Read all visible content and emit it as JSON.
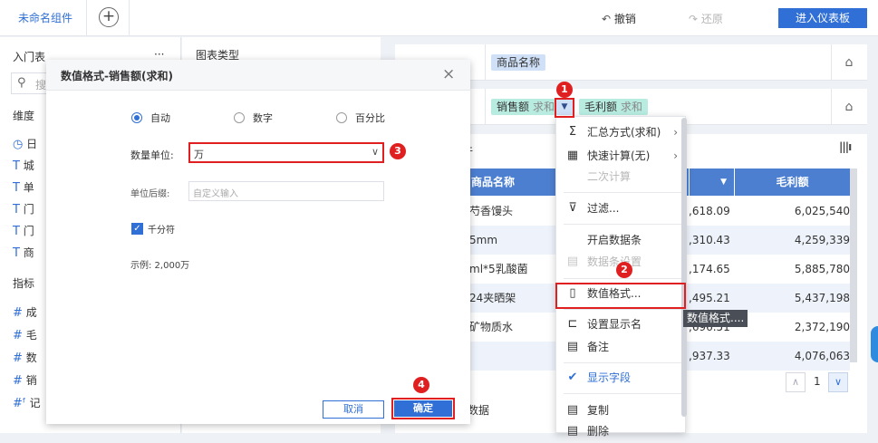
{
  "topbar": {
    "tab_label": "未命名组件",
    "add_icon": "plus-icon",
    "undo_label": "撤销",
    "redo_label": "还原",
    "enter_label": "进入仪表板"
  },
  "left_panel": {
    "title": "入门表",
    "more_label": "···",
    "search_placeholder": "搜",
    "dimension_label": "维度",
    "dimensions": [
      {
        "icon": "◷",
        "label": "日"
      },
      {
        "icon": "T",
        "label": "城"
      },
      {
        "icon": "T",
        "label": "单"
      },
      {
        "icon": "T",
        "label": "门"
      },
      {
        "icon": "T",
        "label": "门"
      },
      {
        "icon": "T",
        "label": "商"
      }
    ],
    "measure_label": "指标",
    "measures": [
      {
        "icon": "#",
        "label": "成"
      },
      {
        "icon": "#",
        "label": "毛"
      },
      {
        "icon": "#",
        "label": "数"
      },
      {
        "icon": "#",
        "label": "销"
      },
      {
        "icon": "#ᶠ",
        "label": "记"
      }
    ]
  },
  "mid_panel": {
    "chart_type_label": "图表类型",
    "data_label": "数据",
    "partial_label": "件"
  },
  "fields": {
    "row1": {
      "pill": "商品名称"
    },
    "row2": {
      "pill1": "销售额",
      "pill1_sub": "求和",
      "pill2": "毛利额",
      "pill2_sub": "求和"
    }
  },
  "table": {
    "headers": [
      "商品名称",
      "",
      "毛利额"
    ],
    "rows": [
      [
        "芍香馒头",
        ",618.09",
        "6,025,540"
      ],
      [
        "5mm",
        ",310.43",
        "4,259,339"
      ],
      [
        "ml*5乳酸菌",
        ",174.65",
        "5,885,780"
      ],
      [
        "24夹晒架",
        ",495.21",
        "5,437,198"
      ],
      [
        "矿物质水",
        ",696.51",
        "2,372,190"
      ],
      [
        "",
        ",937.33",
        "4,076,063"
      ]
    ],
    "page": "1"
  },
  "modal": {
    "title": "数值格式-销售额(求和)",
    "close": "×",
    "radio_options": [
      "自动",
      "数字",
      "百分比"
    ],
    "unit_label": "数量单位:",
    "unit_value": "万",
    "suffix_label": "单位后缀:",
    "suffix_placeholder": "自定义输入",
    "thousands_label": "千分符",
    "example_label": "示例: 2,000万",
    "cancel_label": "取消",
    "ok_label": "确定"
  },
  "context_menu": {
    "items": [
      {
        "icon": "Σ",
        "label": "汇总方式(求和)",
        "arrow": "›",
        "disabled": false
      },
      {
        "icon": "▦",
        "label": "快速计算(无)",
        "arrow": "›",
        "disabled": false
      },
      {
        "icon": "",
        "label": "二次计算",
        "arrow": "",
        "disabled": true
      },
      {
        "icon": "⊽",
        "label": "过滤...",
        "arrow": "",
        "disabled": false
      },
      {
        "icon": "",
        "label": "开启数据条",
        "arrow": "",
        "disabled": false
      },
      {
        "icon": "▤",
        "label": "数据条设置",
        "arrow": "",
        "disabled": true
      },
      {
        "icon": "▯",
        "label": "数值格式...",
        "arrow": "",
        "disabled": false
      },
      {
        "icon": "⊏",
        "label": "设置显示名",
        "arrow": "",
        "disabled": false
      },
      {
        "icon": "▤",
        "label": "备注",
        "arrow": "",
        "disabled": false
      },
      {
        "icon": "✔",
        "label": "显示字段",
        "arrow": "",
        "disabled": false
      },
      {
        "icon": "▤",
        "label": "复制",
        "arrow": "",
        "disabled": false
      },
      {
        "icon": "▤",
        "label": "删除",
        "arrow": "",
        "disabled": false
      }
    ]
  },
  "tooltip": "数值格式....",
  "badges": [
    "1",
    "2",
    "3",
    "4"
  ],
  "colors": {
    "accent": "#2f6fd6",
    "annotation": "#e02020",
    "header": "#4d7fd1"
  }
}
